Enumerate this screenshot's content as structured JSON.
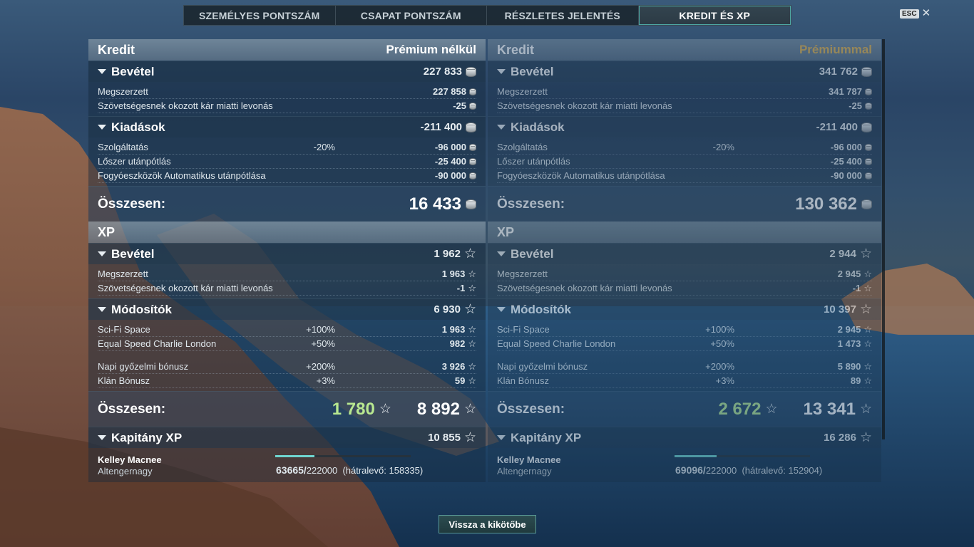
{
  "tabs": [
    "SZEMÉLYES PONTSZÁM",
    "CSAPAT PONTSZÁM",
    "RÉSZLETES JELENTÉS",
    "KREDIT ÉS XP"
  ],
  "esc_label": "ESC",
  "back_button": "Vissza a kikötőbe",
  "colors": {
    "accent": "#4ea8a4",
    "premium": "#e0b04a",
    "xp_highlight": "#b8e890"
  },
  "panels": [
    {
      "credit": {
        "title": "Kredit",
        "subtitle": "Prémium nélkül",
        "income": {
          "label": "Bevétel",
          "value": "227 833",
          "rows": [
            {
              "label": "Megszerzett",
              "value": "227 858"
            },
            {
              "label": "Szövetségesnek okozott kár miatti levonás",
              "value": "-25"
            }
          ]
        },
        "expenses": {
          "label": "Kiadások",
          "value": "-211 400",
          "rows": [
            {
              "label": "Szolgáltatás",
              "pct": "-20%",
              "value": "-96 000"
            },
            {
              "label": "Lőszer utánpótlás",
              "value": "-25 400"
            },
            {
              "label": "Fogyóeszközök Automatikus utánpótlása",
              "value": "-90 000"
            }
          ]
        },
        "total_label": "Összesen:",
        "total": "16 433"
      },
      "xp": {
        "title": "XP",
        "income": {
          "label": "Bevétel",
          "value": "1 962",
          "rows": [
            {
              "label": "Megszerzett",
              "value": "1 963"
            },
            {
              "label": "Szövetségesnek okozott kár miatti levonás",
              "value": "-1"
            }
          ]
        },
        "modifiers": {
          "label": "Módosítók",
          "value": "6 930",
          "rows": [
            {
              "label": "Sci-Fi Space",
              "pct": "+100%",
              "value": "1 963"
            },
            {
              "label": "Equal Speed Charlie London",
              "pct": "+50%",
              "value": "982"
            },
            {
              "label": "Napi győzelmi bónusz",
              "pct": "+200%",
              "value": "3 926"
            },
            {
              "label": "Klán Bónusz",
              "pct": "+3%",
              "value": "59"
            }
          ]
        },
        "total_label": "Összesen:",
        "total_highlight": "1 780",
        "total": "8 892"
      },
      "captain": {
        "label": "Kapitány XP",
        "value": "10 855",
        "name": "Kelley Macnee",
        "rank": "Altengernagy",
        "current": "63665/",
        "max": "222000",
        "remaining": "(hátralevő: 158335)",
        "progress": 0.287
      }
    },
    {
      "credit": {
        "title": "Kredit",
        "subtitle": "Prémiummal",
        "income": {
          "label": "Bevétel",
          "value": "341 762",
          "rows": [
            {
              "label": "Megszerzett",
              "value": "341 787"
            },
            {
              "label": "Szövetségesnek okozott kár miatti levonás",
              "value": "-25"
            }
          ]
        },
        "expenses": {
          "label": "Kiadások",
          "value": "-211 400",
          "rows": [
            {
              "label": "Szolgáltatás",
              "pct": "-20%",
              "value": "-96 000"
            },
            {
              "label": "Lőszer utánpótlás",
              "value": "-25 400"
            },
            {
              "label": "Fogyóeszközök Automatikus utánpótlása",
              "value": "-90 000"
            }
          ]
        },
        "total_label": "Összesen:",
        "total": "130 362"
      },
      "xp": {
        "title": "XP",
        "income": {
          "label": "Bevétel",
          "value": "2 944",
          "rows": [
            {
              "label": "Megszerzett",
              "value": "2 945"
            },
            {
              "label": "Szövetségesnek okozott kár miatti levonás",
              "value": "-1"
            }
          ]
        },
        "modifiers": {
          "label": "Módosítók",
          "value": "10 397",
          "rows": [
            {
              "label": "Sci-Fi Space",
              "pct": "+100%",
              "value": "2 945"
            },
            {
              "label": "Equal Speed Charlie London",
              "pct": "+50%",
              "value": "1 473"
            },
            {
              "label": "Napi győzelmi bónusz",
              "pct": "+200%",
              "value": "5 890"
            },
            {
              "label": "Klán Bónusz",
              "pct": "+3%",
              "value": "89"
            }
          ]
        },
        "total_label": "Összesen:",
        "total_highlight": "2 672",
        "total": "13 341"
      },
      "captain": {
        "label": "Kapitány XP",
        "value": "16 286",
        "name": "Kelley Macnee",
        "rank": "Altengernagy",
        "current": "69096/",
        "max": "222000",
        "remaining": "(hátralevő: 152904)",
        "progress": 0.311
      }
    }
  ]
}
